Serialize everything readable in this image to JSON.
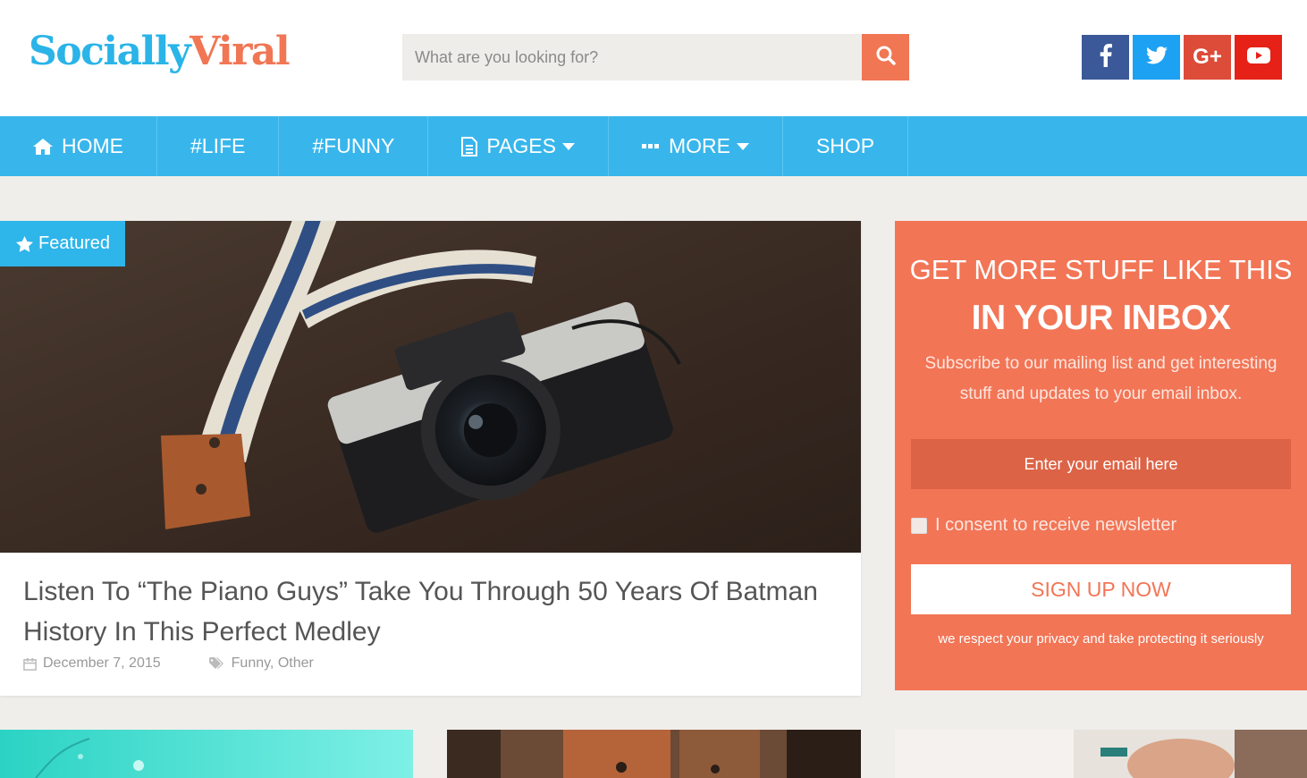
{
  "brand": {
    "logo_part1": "Socially",
    "logo_part2": "Viral"
  },
  "search": {
    "placeholder": "What are you looking for?",
    "icon": "search-icon"
  },
  "social": [
    {
      "name": "facebook",
      "glyph": "f",
      "color": "#3b5998"
    },
    {
      "name": "twitter",
      "glyph": "",
      "color": "#1da1f2"
    },
    {
      "name": "google-plus",
      "glyph": "G+",
      "color": "#dd4b39"
    },
    {
      "name": "youtube",
      "glyph": "",
      "color": "#e62117"
    }
  ],
  "nav": {
    "items": [
      {
        "label": "HOME",
        "icon": "home-icon"
      },
      {
        "label": "#LIFE"
      },
      {
        "label": "#FUNNY"
      },
      {
        "label": "PAGES",
        "icon": "document-icon",
        "dropdown": true
      },
      {
        "label": "MORE",
        "icon": "ellipsis-icon",
        "dropdown": true
      },
      {
        "label": "SHOP"
      }
    ]
  },
  "featured": {
    "badge": "Featured",
    "title": "Listen To “The Piano Guys” Take You Through 50 Years Of Batman History In This Perfect Medley",
    "date": "December 7, 2015",
    "categories": "Funny, Other"
  },
  "subscribe": {
    "heading1": "GET MORE STUFF LIKE THIS",
    "heading2": "IN YOUR INBOX",
    "description": "Subscribe to our mailing list and get interesting stuff and updates to your email inbox.",
    "email_placeholder": "Enter your email here",
    "consent": "I consent to receive newsletter",
    "button": "SIGN UP NOW",
    "note": "we respect your privacy and take protecting it seriously"
  },
  "colors": {
    "accent_blue": "#38b6ec",
    "accent_orange": "#f27556",
    "page_bg": "#f0eeeb"
  }
}
